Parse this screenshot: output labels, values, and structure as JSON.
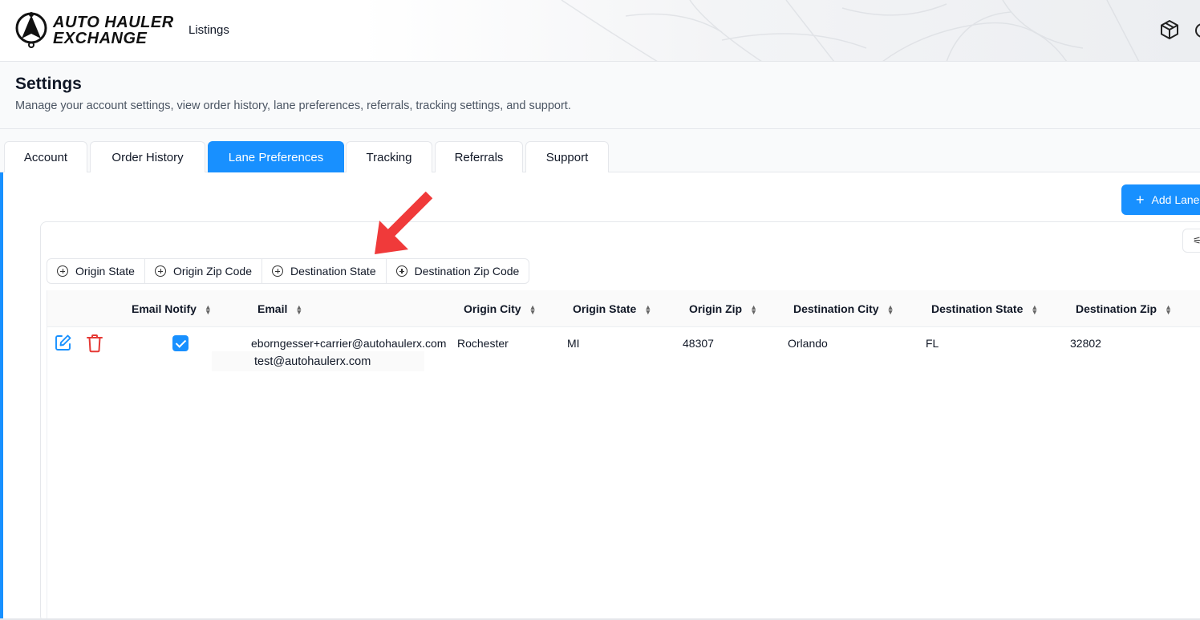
{
  "brand": {
    "line1": "AUTO HAULER",
    "line2": "EXCHANGE"
  },
  "nav": {
    "listings": "Listings"
  },
  "page": {
    "title": "Settings",
    "subtitle": "Manage your account settings, view order history, lane preferences, referrals, tracking settings, and support."
  },
  "tabs": [
    {
      "label": "Account"
    },
    {
      "label": "Order History"
    },
    {
      "label": "Lane Preferences",
      "active": true
    },
    {
      "label": "Tracking"
    },
    {
      "label": "Referrals"
    },
    {
      "label": "Support"
    }
  ],
  "actions": {
    "add_lane": "Add Lane"
  },
  "filters": [
    "Origin State",
    "Origin Zip Code",
    "Destination State",
    "Destination Zip Code"
  ],
  "table": {
    "columns": [
      "Email Notify",
      "Email",
      "Origin City",
      "Origin State",
      "Origin Zip",
      "Destination City",
      "Destination State",
      "Destination Zip"
    ],
    "rows": [
      {
        "email_notify": true,
        "emails": [
          "eborngesser+carrier@autohaulerx.com",
          "test@autohaulerx.com"
        ],
        "origin_city": "Rochester",
        "origin_state": "MI",
        "origin_zip": "48307",
        "destination_city": "Orlando",
        "destination_state": "FL",
        "destination_zip": "32802"
      }
    ]
  },
  "colors": {
    "accent": "#1890ff",
    "delete": "#e53935",
    "annotation_arrow": "#f03a3a"
  },
  "icons": [
    "cube-icon",
    "edit-icon",
    "trash-icon",
    "plus-icon",
    "sort-icon",
    "plus-circle-icon",
    "sliders-icon"
  ]
}
